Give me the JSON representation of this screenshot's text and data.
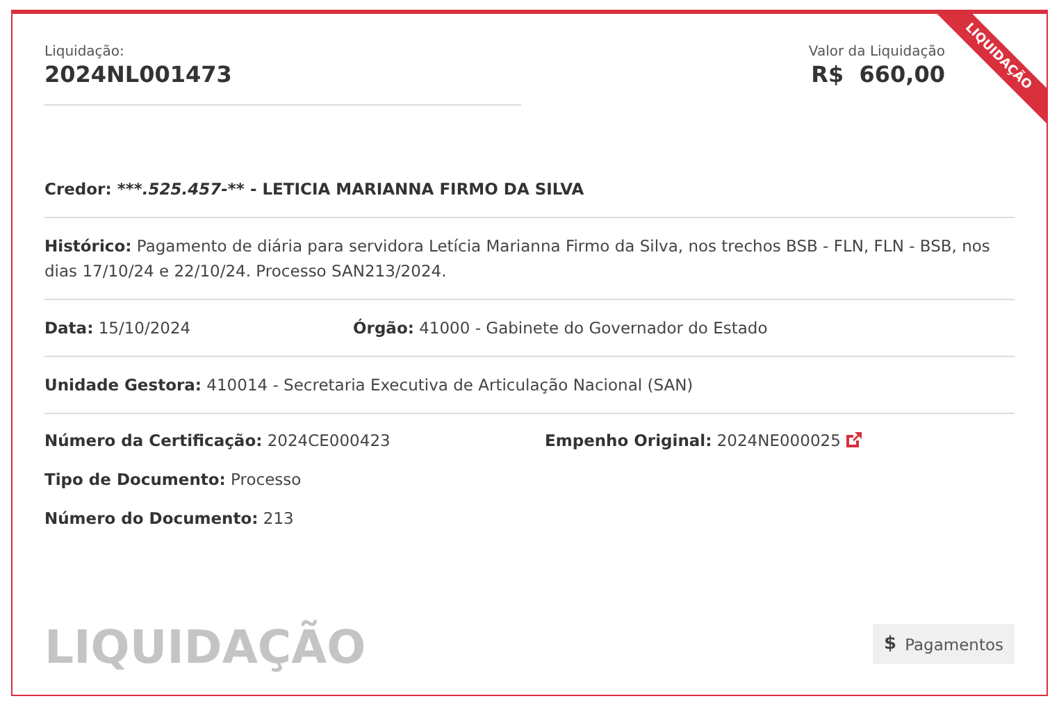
{
  "header": {
    "label": "Liquidação:",
    "number": "2024NL001473",
    "value_label": "Valor da Liquidação",
    "value": "R$  660,00",
    "ribbon": "LIQUIDAÇÃO"
  },
  "credor": {
    "label": "Credor:",
    "masked_id": "***.525.457-**",
    "name": "- LETICIA MARIANNA FIRMO DA SILVA"
  },
  "historico": {
    "label": "Histórico:",
    "value": "Pagamento de diária para servidora Letícia Marianna Firmo da Silva, nos trechos BSB - FLN, FLN - BSB, nos dias 17/10/24 e 22/10/24. Processo SAN213/2024."
  },
  "data": {
    "label": "Data:",
    "value": "15/10/2024"
  },
  "orgao": {
    "label": "Órgão:",
    "value": "41000 - Gabinete do Governador do Estado"
  },
  "unidade_gestora": {
    "label": "Unidade Gestora:",
    "value": "410014 - Secretaria Executiva de Articulação Nacional (SAN)"
  },
  "certificacao": {
    "label": "Número da Certificação:",
    "value": "2024CE000423"
  },
  "empenho_original": {
    "label": "Empenho Original:",
    "value": "2024NE000025"
  },
  "tipo_documento": {
    "label": "Tipo de Documento:",
    "value": "Processo"
  },
  "numero_documento": {
    "label": "Número do Documento:",
    "value": "213"
  },
  "footer": {
    "title": "LIQUIDAÇÃO",
    "button_icon": "$",
    "button": "Pagamentos"
  }
}
